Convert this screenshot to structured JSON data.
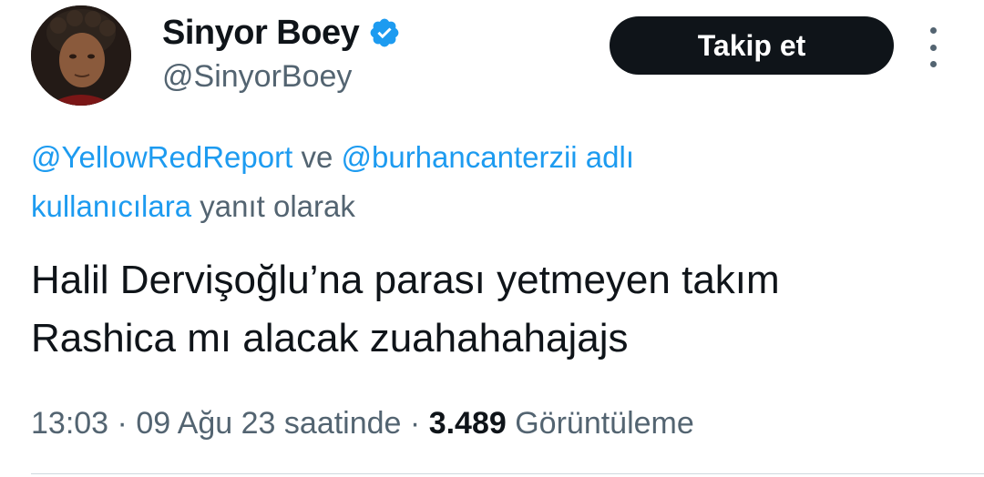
{
  "tweet": {
    "author": {
      "display_name": "Sinyor Boey",
      "handle": "@SinyorBoey",
      "verified": true,
      "verified_icon": "verified-badge-icon",
      "verified_color": "#1d9bf0"
    },
    "follow_button_label": "Takip et",
    "more_icon": "more-vertical-icon",
    "reply_context": {
      "mention_1": "@YellowRedReport",
      "connector": " ve ",
      "mention_2": "@burhancanterzii",
      "mention_2_suffix": " adlı",
      "users_link": "kullanıcılara",
      "tail": " yanıt olarak"
    },
    "text_line_1": "Halil Dervişoğlu’na parası yetmeyen takım",
    "text_line_2": "Rashica mı alacak zuahahahajajs",
    "time": "13:03",
    "separator": " · ",
    "date": "09 Ağu 23 saatinde",
    "views_count": "3.489",
    "views_label": " Görüntüleme"
  },
  "colors": {
    "text_primary": "#0f1419",
    "text_secondary": "#536471",
    "link": "#1d9bf0",
    "button_bg": "#0f1419",
    "divider": "#cfd9de"
  }
}
